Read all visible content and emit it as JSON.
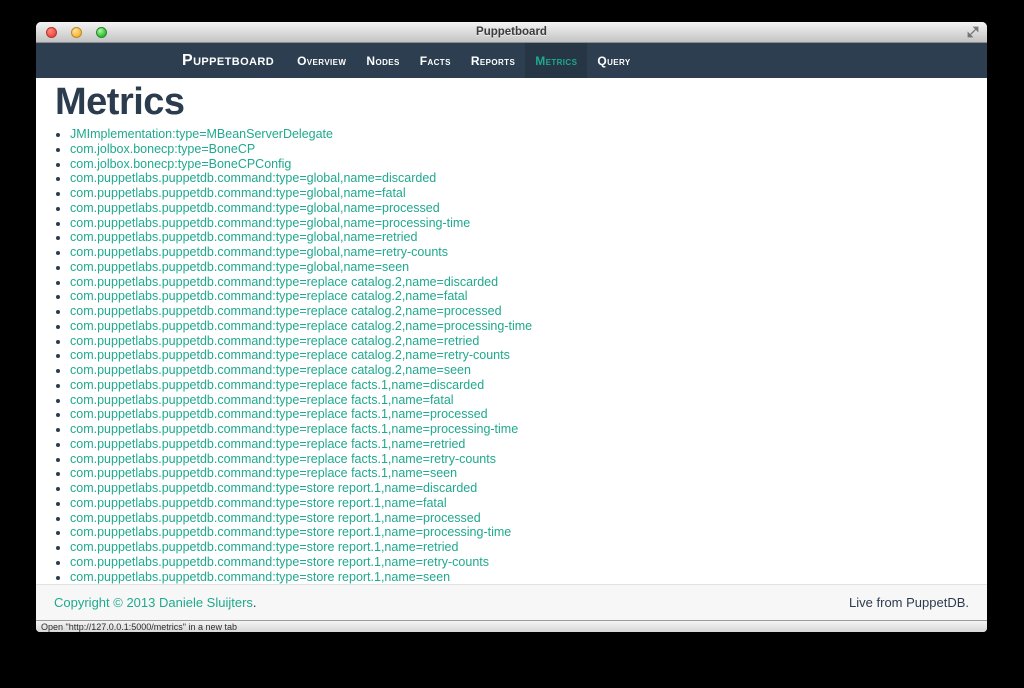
{
  "window": {
    "title": "Puppetboard"
  },
  "navbar": {
    "brand": "Puppetboard",
    "items": [
      {
        "label": "Overview",
        "active": false
      },
      {
        "label": "Nodes",
        "active": false
      },
      {
        "label": "Facts",
        "active": false
      },
      {
        "label": "Reports",
        "active": false
      },
      {
        "label": "Metrics",
        "active": true
      },
      {
        "label": "Query",
        "active": false
      }
    ]
  },
  "page": {
    "heading": "Metrics"
  },
  "metrics": {
    "items": [
      "JMImplementation:type=MBeanServerDelegate",
      "com.jolbox.bonecp:type=BoneCP",
      "com.jolbox.bonecp:type=BoneCPConfig",
      "com.puppetlabs.puppetdb.command:type=global,name=discarded",
      "com.puppetlabs.puppetdb.command:type=global,name=fatal",
      "com.puppetlabs.puppetdb.command:type=global,name=processed",
      "com.puppetlabs.puppetdb.command:type=global,name=processing-time",
      "com.puppetlabs.puppetdb.command:type=global,name=retried",
      "com.puppetlabs.puppetdb.command:type=global,name=retry-counts",
      "com.puppetlabs.puppetdb.command:type=global,name=seen",
      "com.puppetlabs.puppetdb.command:type=replace catalog.2,name=discarded",
      "com.puppetlabs.puppetdb.command:type=replace catalog.2,name=fatal",
      "com.puppetlabs.puppetdb.command:type=replace catalog.2,name=processed",
      "com.puppetlabs.puppetdb.command:type=replace catalog.2,name=processing-time",
      "com.puppetlabs.puppetdb.command:type=replace catalog.2,name=retried",
      "com.puppetlabs.puppetdb.command:type=replace catalog.2,name=retry-counts",
      "com.puppetlabs.puppetdb.command:type=replace catalog.2,name=seen",
      "com.puppetlabs.puppetdb.command:type=replace facts.1,name=discarded",
      "com.puppetlabs.puppetdb.command:type=replace facts.1,name=fatal",
      "com.puppetlabs.puppetdb.command:type=replace facts.1,name=processed",
      "com.puppetlabs.puppetdb.command:type=replace facts.1,name=processing-time",
      "com.puppetlabs.puppetdb.command:type=replace facts.1,name=retried",
      "com.puppetlabs.puppetdb.command:type=replace facts.1,name=retry-counts",
      "com.puppetlabs.puppetdb.command:type=replace facts.1,name=seen",
      "com.puppetlabs.puppetdb.command:type=store report.1,name=discarded",
      "com.puppetlabs.puppetdb.command:type=store report.1,name=fatal",
      "com.puppetlabs.puppetdb.command:type=store report.1,name=processed",
      "com.puppetlabs.puppetdb.command:type=store report.1,name=processing-time",
      "com.puppetlabs.puppetdb.command:type=store report.1,name=retried",
      "com.puppetlabs.puppetdb.command:type=store report.1,name=retry-counts",
      "com.puppetlabs.puppetdb.command:type=store report.1,name=seen"
    ]
  },
  "footer": {
    "copyright_link": "Copyright © 2013 Daniele Sluijters",
    "copyright_suffix": ".",
    "live_text": "Live from PuppetDB."
  },
  "statusbar": {
    "text": "Open \"http://127.0.0.1:5000/metrics\" in a new tab"
  },
  "colors": {
    "accent_teal": "#1fa98e",
    "navbar_bg": "#2d3e50",
    "navbar_active_bg": "#263645",
    "heading": "#2b3c4f"
  }
}
